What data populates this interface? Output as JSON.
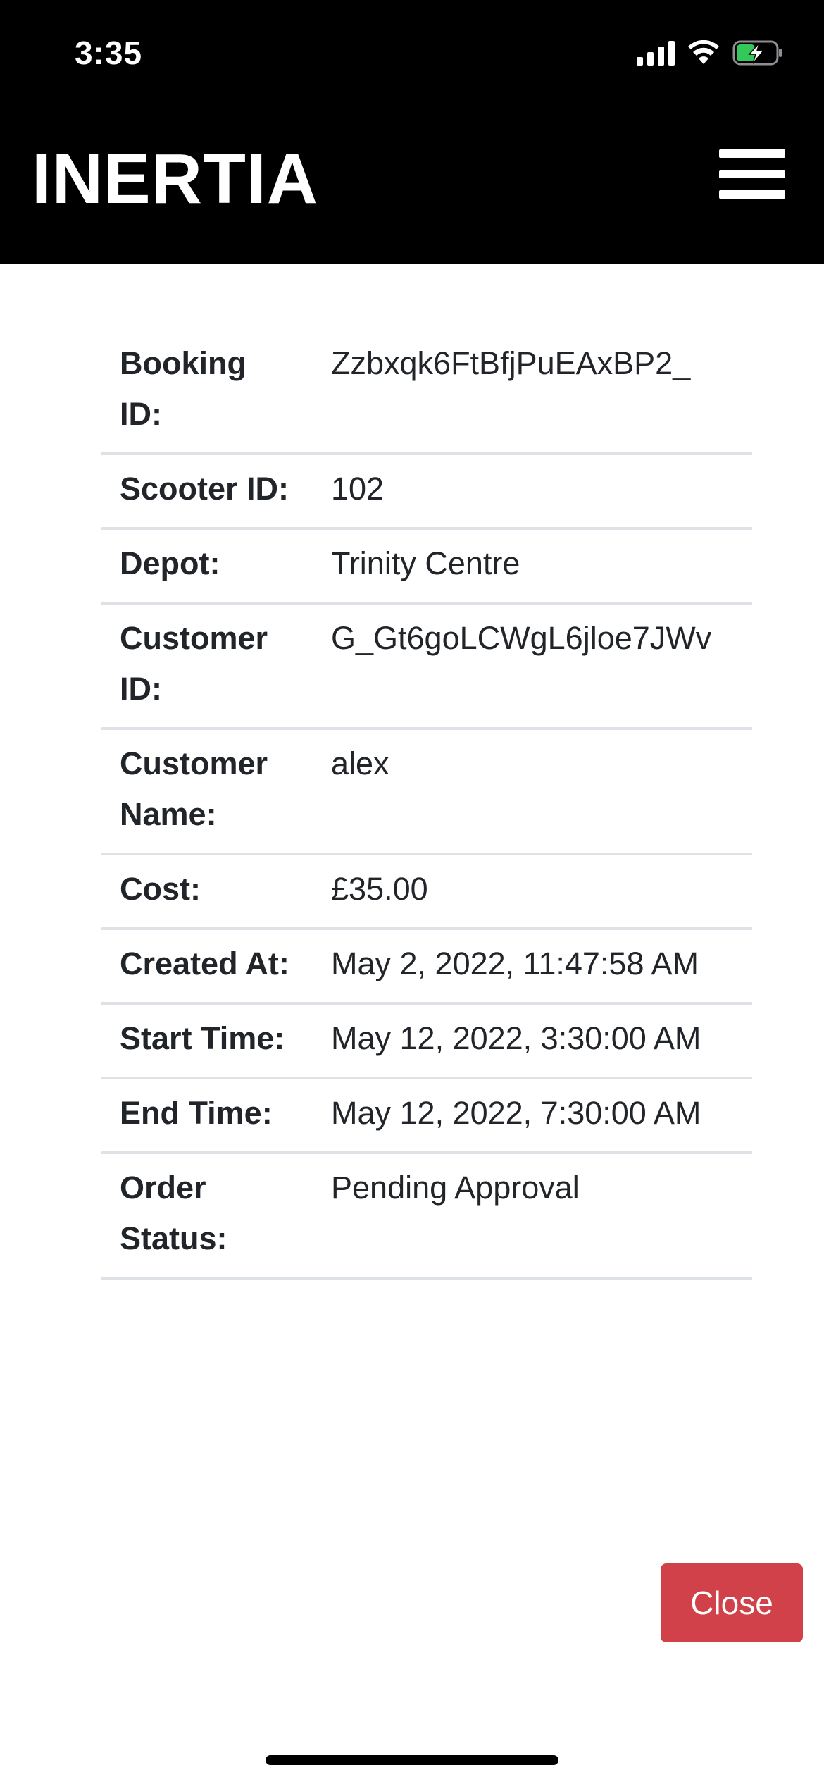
{
  "status_bar": {
    "time": "3:35",
    "icons": [
      "cellular-signal-icon",
      "wifi-icon",
      "battery-charging-icon"
    ],
    "battery_color": "#34c759"
  },
  "navbar": {
    "brand": "INERTIA",
    "menu_icon": "hamburger-menu-icon"
  },
  "booking": {
    "rows": [
      {
        "label": "Booking ID:",
        "value": "Zzbxqk6FtBfjPuEAxBP2_"
      },
      {
        "label": "Scooter ID:",
        "value": "102"
      },
      {
        "label": "Depot:",
        "value": "Trinity Centre"
      },
      {
        "label": "Customer ID:",
        "value": "G_Gt6goLCWgL6jloe7JWv"
      },
      {
        "label": "Customer Name:",
        "value": "alex"
      },
      {
        "label": "Cost:",
        "value": "£35.00"
      },
      {
        "label": "Created At:",
        "value": "May 2, 2022, 11:47:58 AM"
      },
      {
        "label": "Start Time:",
        "value": "May 12, 2022, 3:30:00 AM"
      },
      {
        "label": "End Time:",
        "value": "May 12, 2022, 7:30:00 AM"
      },
      {
        "label": "Order Status:",
        "value": "Pending Approval"
      }
    ]
  },
  "actions": {
    "close_label": "Close",
    "close_color": "#d0414a"
  }
}
